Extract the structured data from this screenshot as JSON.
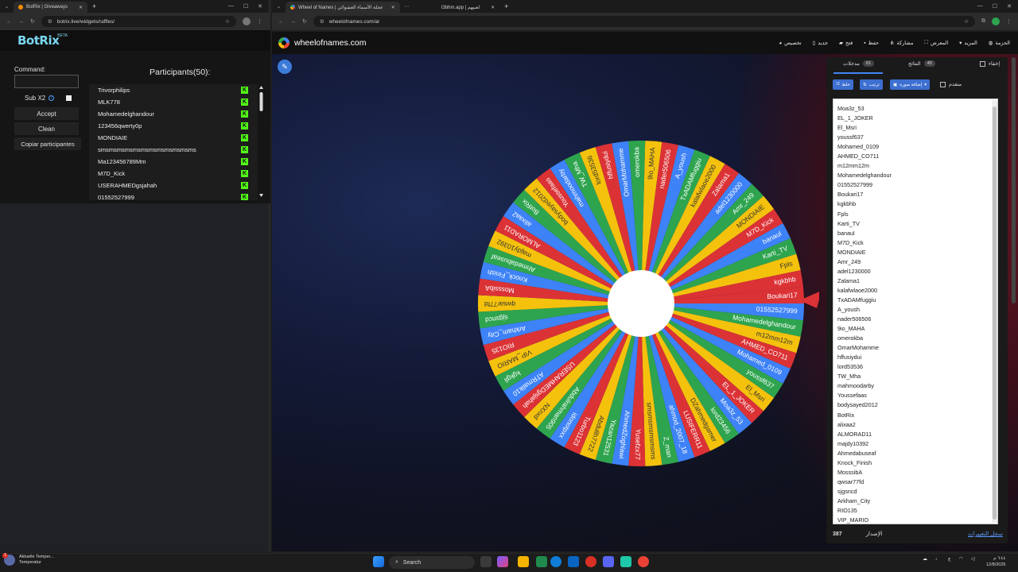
{
  "left_window": {
    "tab_title": "BotRix | Giveaways",
    "url": "botrix.live/widgets/raffles/"
  },
  "right_window": {
    "tabs": [
      {
        "title": "Wheel of Names | عجلة الأسماء العشوائي"
      },
      {
        "title": "I3bhm.app | لعبيهم"
      }
    ],
    "url": "wheelofnames.com/ar"
  },
  "botrix": {
    "logo": "BotRix",
    "beta": "BETA",
    "command_label": "Command:",
    "sub_label": "Sub X2",
    "accept": "Accept",
    "clean": "Clean",
    "copy": "Copiar participantes",
    "participants_title": "Participants(50):",
    "participants": [
      "Trivorphilips",
      "MLK778",
      "Mohamedelghandour",
      "123456qwerty0p",
      "MONDIAIE",
      "smsmsmsmsmsmsmsmsmsmsmsms",
      "Ma123456789Mm",
      "M7D_Kick",
      "USERAHMEDgsjahah",
      "01552527999"
    ]
  },
  "won": {
    "logo": "wheelofnames.com",
    "menu": [
      "تخصيص",
      "جديد",
      "فتح",
      "حفظ",
      "مشاركة",
      "المعرض",
      "المزيد",
      "الحزمة"
    ],
    "tabs": {
      "entries_label": "مدخلات",
      "entries_count": "61",
      "results_label": "النتائج",
      "results_count": "45",
      "hide_label": "إخفاء"
    },
    "toolbar": {
      "shuffle": "خلط",
      "sort": "ترتيب",
      "add_image": "إضافة صورة",
      "advanced": "متقدم"
    },
    "entries": [
      "Moa3z_53",
      "EL_1_JOKER",
      "El_Msri",
      "youssf637",
      "Mohamed_0109",
      "AHMED_CO711",
      "m12mm12m",
      "Mohamedelghandour",
      "01552527999",
      "Boukari17",
      "kgkbhb",
      "Fpls",
      "Karti_TV",
      "banaul",
      "M7D_Kick",
      "MONDIAIE",
      "Amr_249",
      "adel1230000",
      "Zalama1",
      "kalafwlaoe2000",
      "TxADAMfuggiu",
      "A_yoush",
      "nader506506",
      "9io_MAHA",
      "omerokba",
      "OmarMohamme",
      "hffusiydui",
      "lord53536",
      "TW_Mha",
      "mahmoodarby",
      "Youssefaas",
      "bodysayed2012",
      "BotRix",
      "alixaa2",
      "ALMORAD11",
      "majdy10392",
      "Ahmedabuseaf",
      "Knock_Finish",
      "MosssibA",
      "qwsar77fd",
      "sjgsncd",
      "Arkham_City",
      "RIO135",
      "VIP_MARIO"
    ],
    "footer_version_label": "الإصدار",
    "footer_version": "387",
    "footer_link": "سجل التغييرات"
  },
  "wheel": {
    "colors": [
      "#db3236",
      "#3e82f7",
      "#2ea44f",
      "#f4c20d"
    ],
    "segments": [
      "Boukari17",
      "01552527999",
      "Mohamedelghandour",
      "m12mm12m",
      "AHMED_CO711",
      "Mohamed_0109",
      "youssf637",
      "El_Msri",
      "EL_1_JOKER",
      "Moa3z_53",
      "lord23456",
      "DZahmedgamer",
      "LUSIFERR11",
      "ahmod_2007_18",
      "Z_man",
      "smsmsmsmsmsms",
      "Yusefzx77",
      "AhmedZoghlawi",
      "Yazan12531",
      "Abdullh7722",
      "Turbo1123",
      "idonotpxx",
      "Abdulrahman905",
      "NXnxd",
      "USERAHMEDgsjahah",
      "ATRmalik10",
      "kgkgli",
      "VIP_MARIO",
      "RIO135",
      "Arkham_City",
      "sjgsncd",
      "qwsar77fd",
      "MosssibA",
      "Knock_Finish",
      "Ahmedabuseaf",
      "majdy10392",
      "ALMORAD11",
      "alixaa2",
      "BotRix",
      "bodysayed2012",
      "Youssefaas",
      "mahmoodarby",
      "TW_Mha",
      "lord53536",
      "hffusiydui",
      "OmarMohamme",
      "omerokba",
      "9io_MAHA",
      "nader506506",
      "A_yoush",
      "TxADAMfuggiu",
      "kalafwlaoe2000",
      "Zalama1",
      "adel1230000",
      "Amr_249",
      "MONDIAIE",
      "M7D_Kick",
      "banaul",
      "Karti_TV",
      "Fpls",
      "kgkbhb"
    ]
  },
  "taskbar": {
    "weather_title": "Aktuelle Temper...",
    "weather_sub": "Temperatur",
    "search": "Search",
    "time": "٦:٤٤ م",
    "date": "12/8/2025",
    "notification_count": "1"
  }
}
